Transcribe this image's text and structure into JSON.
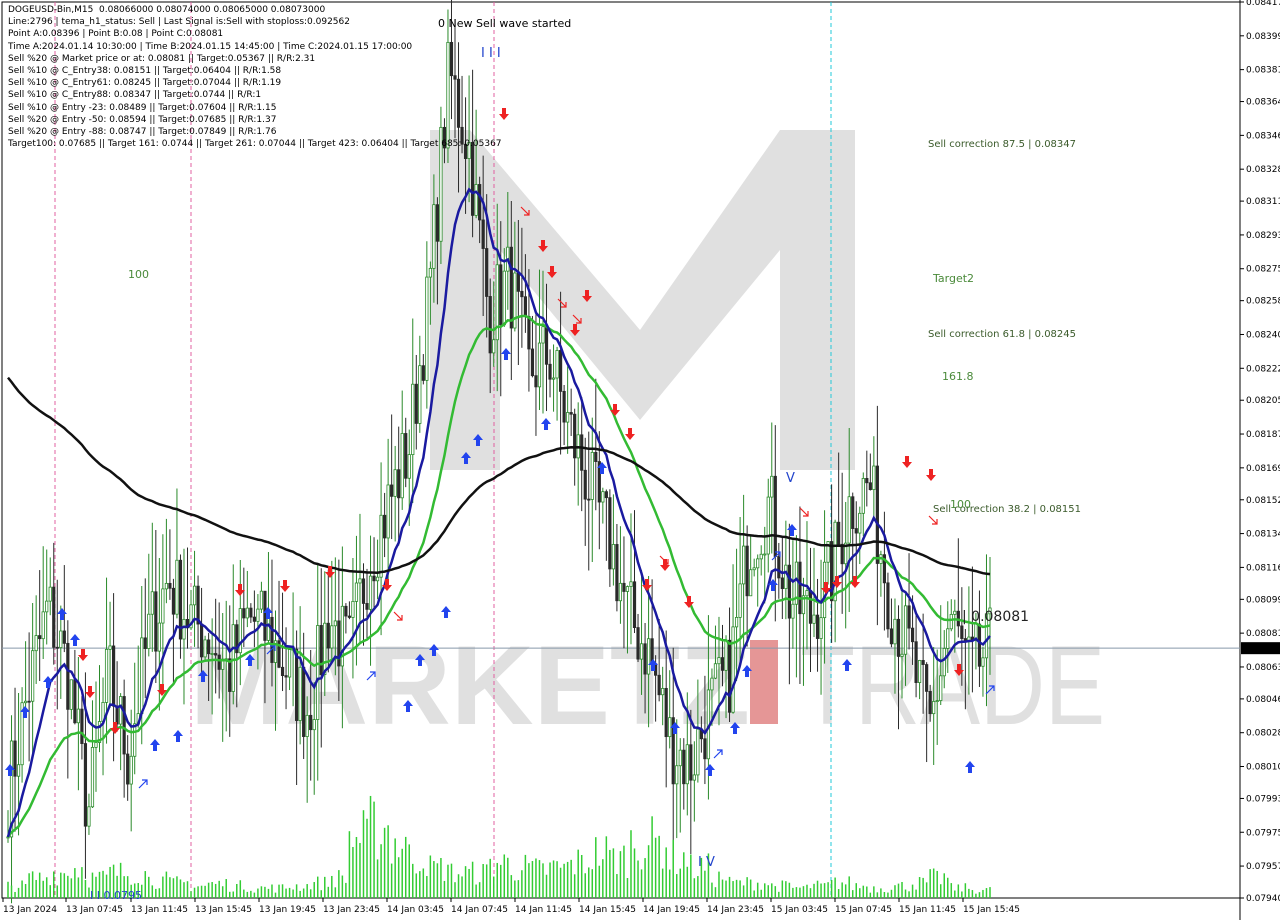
{
  "info": {
    "lines": [
      "DOGEUSD-Bin,M15  0.08066000 0.08074000 0.08065000 0.08073000",
      "Line:2796 | tema_h1_status: Sell | Last Signal is:Sell with stoploss:0.092562",
      "Point A:0.08396 | Point B:0.08 | Point C:0.08081",
      "Time A:2024.01.14 10:30:00 | Time B:2024.01.15 14:45:00 | Time C:2024.01.15 17:00:00",
      "Sell %20 @ Market price or at: 0.08081 || Target:0.05367 || R/R:2.31",
      "Sell %10 @ C_Entry38: 0.08151 || Target:0.06404 || R/R:1.58",
      "Sell %10 @ C_Entry61: 0.08245 || Target:0.07044 || R/R:1.19",
      "Sell %10 @ C_Entry88: 0.08347 || Target:0.0744 || R/R:1",
      "Sell %10 @ Entry -23: 0.08489 || Target:0.07604 || R/R:1.15",
      "Sell %20 @ Entry -50: 0.08594 || Target:0.07685 || R/R:1.37",
      "Sell %20 @ Entry -88: 0.08747 || Target:0.07849 || R/R:1.76",
      "Target100: 0.07685 || Target 161: 0.0744 || Target 261: 0.07044 || Target 423: 0.06404 || Target 685: 0.05367"
    ]
  },
  "chart_data": {
    "type": "candlestick",
    "symbol": "DOGEUSD-Bin",
    "timeframe": "M15",
    "ylim": [
      0.0794,
      0.08417
    ],
    "y_ticks": [
      "0.08417",
      "0.08399",
      "0.08381",
      "0.08364",
      "0.08346",
      "0.08328",
      "0.08311",
      "0.08293",
      "0.08275",
      "0.08258",
      "0.08240",
      "0.08222",
      "0.08205",
      "0.08187",
      "0.08169",
      "0.08152",
      "0.08134",
      "0.08116",
      "0.08099",
      "0.08081",
      "0.08063",
      "0.08046",
      "0.08028",
      "0.08010",
      "0.07993",
      "0.07975",
      "0.07957",
      "0.07940"
    ],
    "x_ticks": [
      "13 Jan 2024",
      "13 Jan 07:45",
      "13 Jan 11:45",
      "13 Jan 15:45",
      "13 Jan 19:45",
      "13 Jan 23:45",
      "14 Jan 03:45",
      "14 Jan 07:45",
      "14 Jan 11:45",
      "14 Jan 15:45",
      "14 Jan 19:45",
      "14 Jan 23:45",
      "15 Jan 03:45",
      "15 Jan 07:45",
      "15 Jan 11:45",
      "15 Jan 15:45"
    ],
    "current_price": "0.08073",
    "price_path": [
      0.07995,
      0.0805,
      0.08095,
      0.0806,
      0.07985,
      0.0806,
      0.08015,
      0.0808,
      0.0811,
      0.0809,
      0.0808,
      0.0806,
      0.0809,
      0.0808,
      0.0806,
      0.0804,
      0.0809,
      0.0807,
      0.0812,
      0.0815,
      0.0818,
      0.0826,
      0.0838,
      0.0834,
      0.0825,
      0.0827,
      0.0822,
      0.0823,
      0.0819,
      0.0816,
      0.0813,
      0.0809,
      0.0807,
      0.08025,
      0.0801,
      0.0804,
      0.0806,
      0.0813,
      0.0815,
      0.081,
      0.0809,
      0.0811,
      0.0815,
      0.0816,
      0.081,
      0.0807,
      0.0803,
      0.0809,
      0.0806,
      0.08073
    ],
    "volume_path": [
      12,
      20,
      25,
      30,
      20,
      25,
      25,
      18,
      15,
      12,
      14,
      12,
      10,
      10,
      12,
      15,
      20,
      60,
      70,
      55,
      40,
      30,
      25,
      25,
      35,
      30,
      28,
      30,
      35,
      45,
      40,
      55,
      55,
      40,
      30,
      20,
      15,
      15,
      12,
      10,
      12,
      15,
      12,
      10,
      12,
      15,
      20,
      10,
      8,
      8
    ],
    "annotations": {
      "wave_text": "0 New Sell wave started",
      "sell_corr_875": "Sell correction 87.5 | 0.08347",
      "sell_corr_618": "Sell correction 61.8 | 0.08245",
      "sell_corr_382": "Sell correction 38.2 | 0.08151",
      "target2": "Target2",
      "fib_1618": "161.8",
      "fib_100a": "100",
      "fib_100b": "100",
      "point_c": "| 0.08081",
      "wave_i": "I I I",
      "wave_v": "V",
      "wave_iv": "I V",
      "bottom_label": "I I 0.0795"
    },
    "colors": {
      "bull": "#2a8a2a",
      "bear": "#2a2a2a",
      "ema_fast": "#1a1aa0",
      "ema_mid": "#33bb33",
      "ema_slow": "#111111",
      "volume": "#33cc33",
      "magenta_vline": "#e060a0",
      "cyan_vline": "#22c8d8",
      "watermark": "#e0e0e0",
      "watermark_red": "#d04040",
      "arrow_up": "#2244ee",
      "arrow_down": "#ee2222"
    },
    "watermark_text": "MARKETZITRADE"
  }
}
